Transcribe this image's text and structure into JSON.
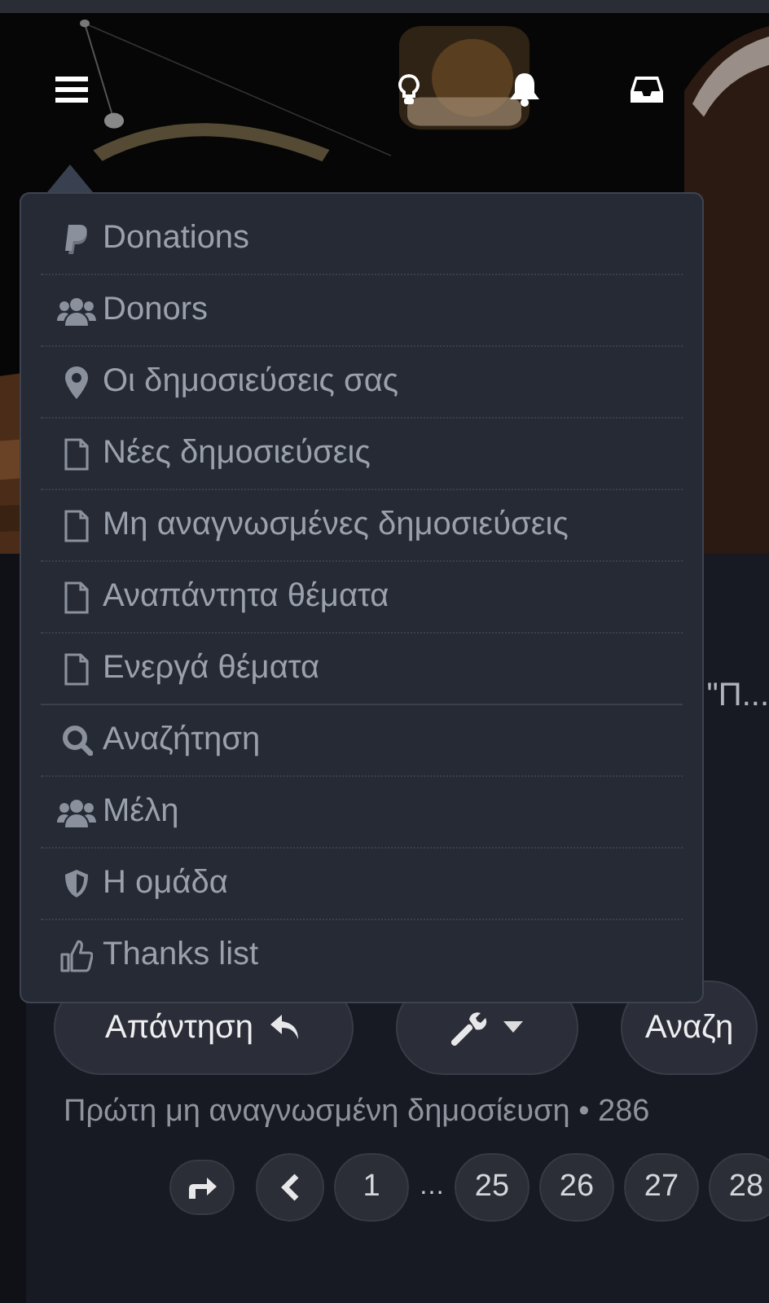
{
  "menu": {
    "items": [
      {
        "label": "Donations",
        "kind": "paypal",
        "section_end": false
      },
      {
        "label": "Donors",
        "kind": "users",
        "section_end": false
      },
      {
        "label": "Οι δημοσιεύσεις σας",
        "kind": "pin",
        "section_end": false
      },
      {
        "label": "Νέες δημοσιεύσεις",
        "kind": "file",
        "section_end": false
      },
      {
        "label": "Μη αναγνωσμένες δημοσιεύσεις",
        "kind": "file",
        "section_end": false
      },
      {
        "label": "Αναπάντητα θέματα",
        "kind": "file",
        "section_end": false
      },
      {
        "label": "Ενεργά θέματα",
        "kind": "file",
        "section_end": true
      },
      {
        "label": "Αναζήτηση",
        "kind": "search",
        "section_end": false
      },
      {
        "label": "Μέλη",
        "kind": "users",
        "section_end": false
      },
      {
        "label": "Η ομάδα",
        "kind": "shield",
        "section_end": false
      },
      {
        "label": "Thanks list",
        "kind": "thumb"
      }
    ]
  },
  "topic_title": "\"Π...",
  "buttons": [
    {
      "label": "Απάντηση",
      "kind": "reply"
    },
    {
      "kind": "tools"
    },
    {
      "label": "Αναζη",
      "kind": "search"
    }
  ],
  "status_line": "Πρώτη μη αναγνωσμένη δημοσίευση • 286",
  "pagination": [
    {
      "kind": "jump"
    },
    {
      "kind": "prev"
    },
    {
      "label": "1",
      "kind": "page"
    },
    {
      "label": "…",
      "kind": "gap"
    },
    {
      "label": "25",
      "kind": "page"
    },
    {
      "label": "26",
      "kind": "page"
    },
    {
      "label": "27",
      "kind": "page"
    },
    {
      "label": "28",
      "kind": "page"
    }
  ]
}
